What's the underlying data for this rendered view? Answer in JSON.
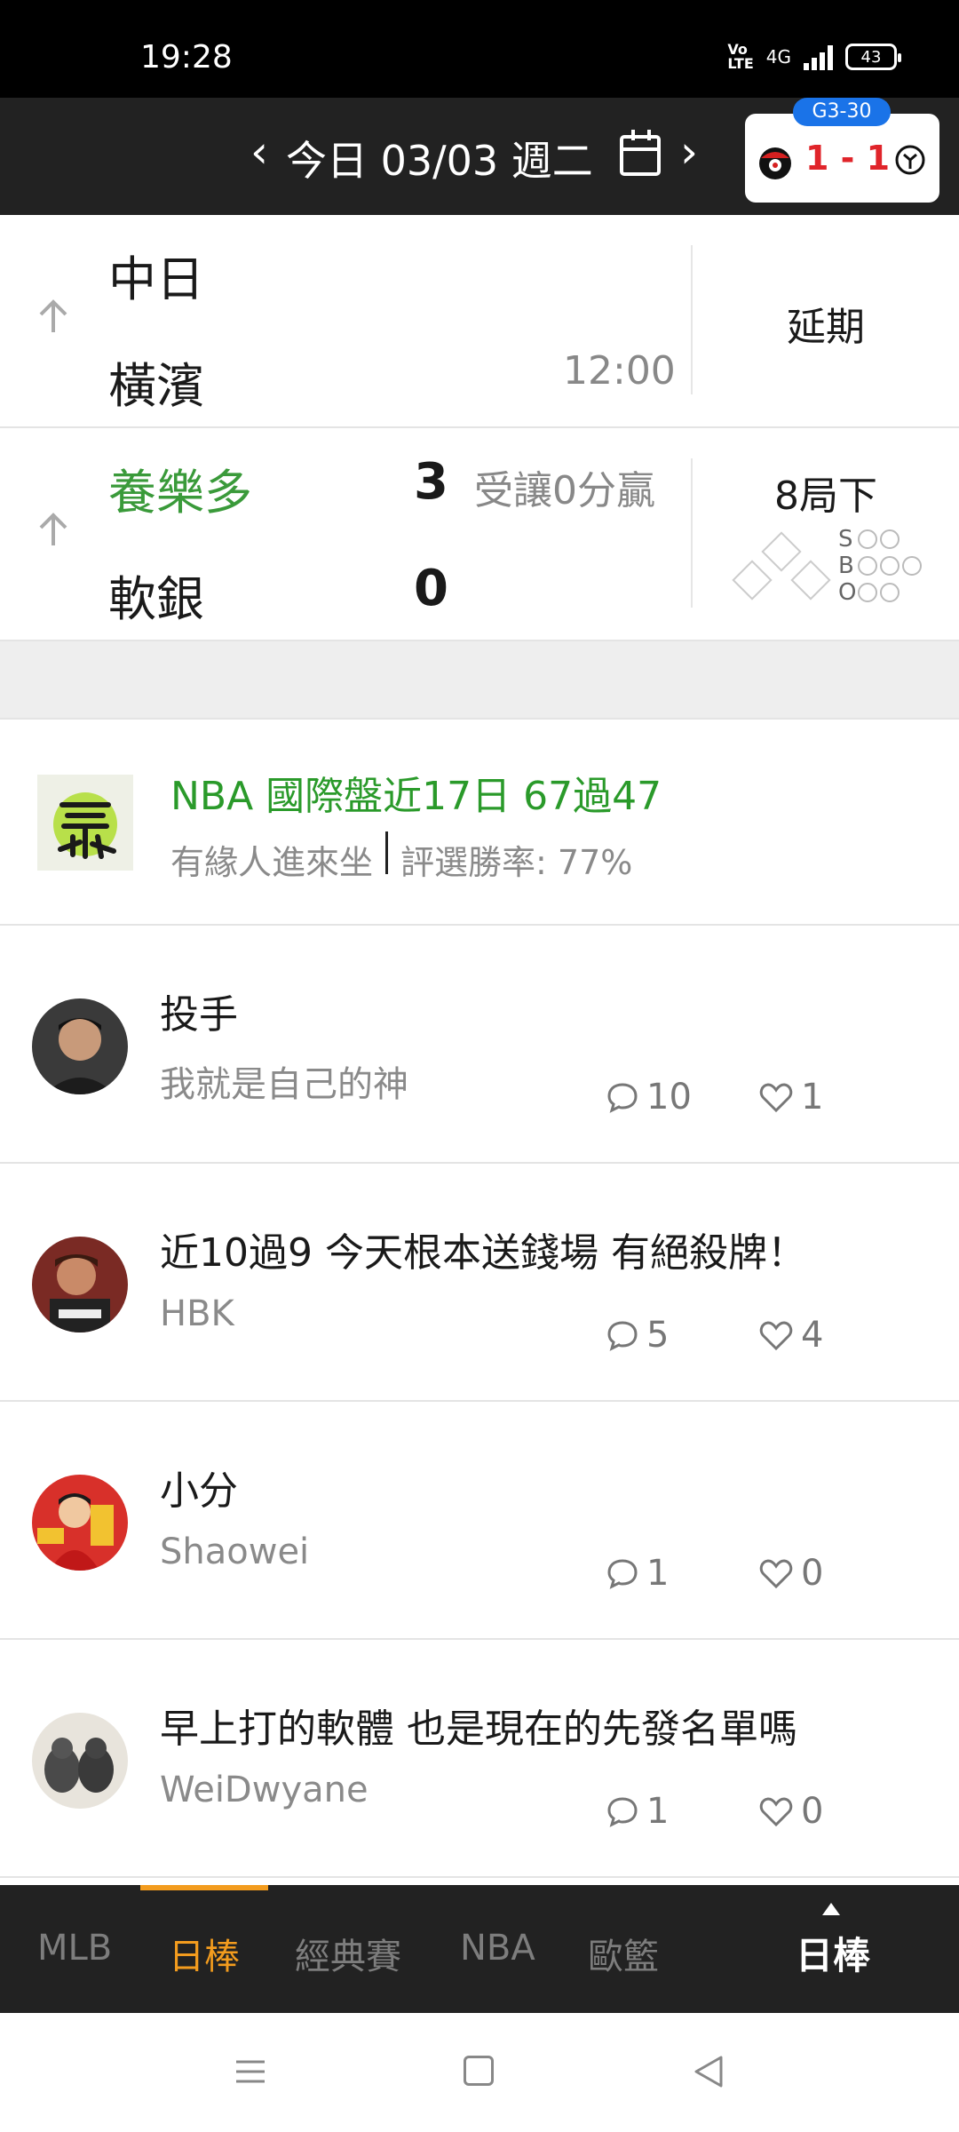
{
  "status_bar": {
    "time": "19:28",
    "network": "4G",
    "battery": "43"
  },
  "date_bar": {
    "label": "今日 03/03 週二",
    "series_badge": "G3-30",
    "score": "1 - 1"
  },
  "games": [
    {
      "home": "中日",
      "away": "橫濱",
      "time": "12:00",
      "status": "延期"
    },
    {
      "home": "養樂多",
      "away": "軟銀",
      "home_score": "3",
      "away_score": "0",
      "handicap": "受讓0分贏",
      "status": "8局下",
      "sbo_labels": [
        "S",
        "B",
        "O"
      ]
    }
  ],
  "promo": {
    "title": "NBA 國際盤近17日 67過47",
    "user": "有緣人進來坐",
    "win_rate": "評選勝率: 77%"
  },
  "posts": [
    {
      "title": "投手",
      "author": "我就是自己的神",
      "comments": "10",
      "likes": "1"
    },
    {
      "title": "近10過9 今天根本送錢場 有絕殺牌！",
      "author": "HBK",
      "comments": "5",
      "likes": "4"
    },
    {
      "title": "小分",
      "author": "Shaowei",
      "comments": "1",
      "likes": "0"
    },
    {
      "title": "早上打的軟體 也是現在的先發名單嗎",
      "author": "WeiDwyane",
      "comments": "1",
      "likes": "0"
    }
  ],
  "tabs": [
    "MLB",
    "日棒",
    "經典賽",
    "NBA",
    "歐籃"
  ],
  "active_tab": "日棒",
  "right_tab": "日棒",
  "colors": {
    "accent": "#f39c1e",
    "win_green": "#3a9a3a",
    "score_red": "#e0242a",
    "badge_blue": "#1a73e8"
  }
}
